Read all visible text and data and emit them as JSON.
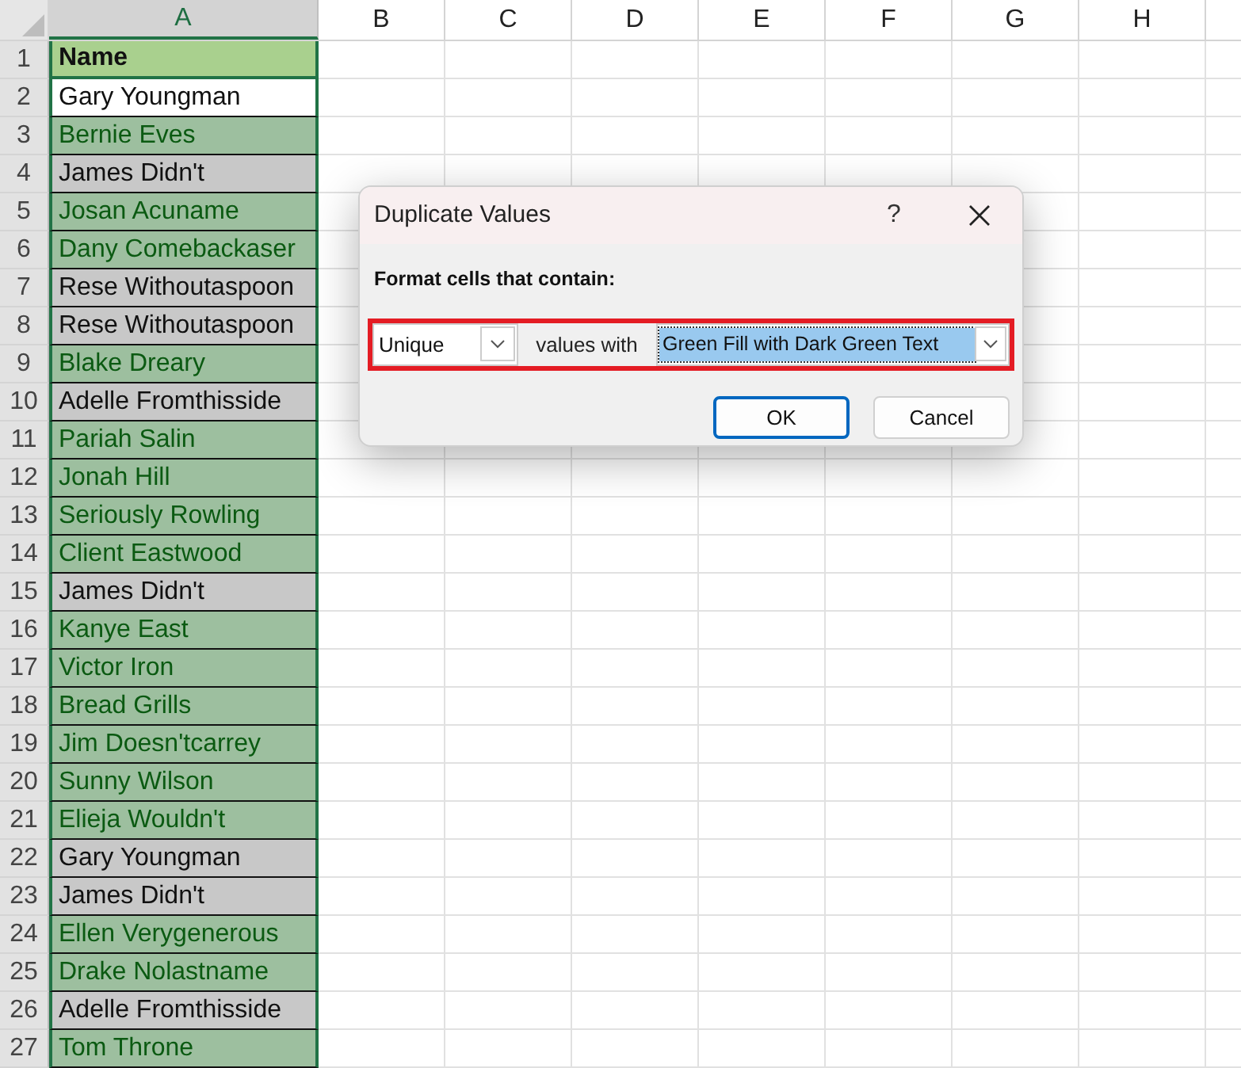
{
  "sheet": {
    "columns": [
      {
        "label": "A",
        "selected": true
      },
      {
        "label": "B",
        "selected": false
      },
      {
        "label": "C",
        "selected": false
      },
      {
        "label": "D",
        "selected": false
      },
      {
        "label": "E",
        "selected": false
      },
      {
        "label": "F",
        "selected": false
      },
      {
        "label": "G",
        "selected": false
      },
      {
        "label": "H",
        "selected": false
      }
    ],
    "rows": [
      {
        "number": "1",
        "value": "Name",
        "kind": "header"
      },
      {
        "number": "2",
        "value": "Gary Youngman",
        "kind": "active"
      },
      {
        "number": "3",
        "value": "Bernie Eves",
        "kind": "unique"
      },
      {
        "number": "4",
        "value": "James Didn't",
        "kind": "duplicate"
      },
      {
        "number": "5",
        "value": "Josan Acuname",
        "kind": "unique"
      },
      {
        "number": "6",
        "value": "Dany Comebackaser",
        "kind": "unique"
      },
      {
        "number": "7",
        "value": "Rese Withoutaspoon",
        "kind": "duplicate"
      },
      {
        "number": "8",
        "value": "Rese Withoutaspoon",
        "kind": "duplicate"
      },
      {
        "number": "9",
        "value": "Blake Dreary",
        "kind": "unique"
      },
      {
        "number": "10",
        "value": "Adelle Fromthisside",
        "kind": "duplicate"
      },
      {
        "number": "11",
        "value": "Pariah Salin",
        "kind": "unique"
      },
      {
        "number": "12",
        "value": "Jonah Hill",
        "kind": "unique"
      },
      {
        "number": "13",
        "value": "Seriously Rowling",
        "kind": "unique"
      },
      {
        "number": "14",
        "value": "Client Eastwood",
        "kind": "unique"
      },
      {
        "number": "15",
        "value": "James Didn't",
        "kind": "duplicate"
      },
      {
        "number": "16",
        "value": "Kanye East",
        "kind": "unique"
      },
      {
        "number": "17",
        "value": "Victor Iron",
        "kind": "unique"
      },
      {
        "number": "18",
        "value": "Bread Grills",
        "kind": "unique"
      },
      {
        "number": "19",
        "value": "Jim Doesn'tcarrey",
        "kind": "unique"
      },
      {
        "number": "20",
        "value": "Sunny Wilson",
        "kind": "unique"
      },
      {
        "number": "21",
        "value": "Elieja Wouldn't",
        "kind": "unique"
      },
      {
        "number": "22",
        "value": "Gary Youngman",
        "kind": "duplicate"
      },
      {
        "number": "23",
        "value": "James Didn't",
        "kind": "duplicate"
      },
      {
        "number": "24",
        "value": "Ellen Verygenerous",
        "kind": "unique"
      },
      {
        "number": "25",
        "value": "Drake Nolastname",
        "kind": "unique"
      },
      {
        "number": "26",
        "value": "Adelle Fromthisside",
        "kind": "duplicate"
      },
      {
        "number": "27",
        "value": "Tom Throne",
        "kind": "unique"
      }
    ]
  },
  "dialog": {
    "title": "Duplicate Values",
    "help": "?",
    "prompt": "Format cells that contain:",
    "rule_type": "Unique",
    "connector": "values with",
    "format": "Green Fill with Dark Green Text",
    "format_highlighted": true,
    "buttons": [
      {
        "label": "OK",
        "default": true
      },
      {
        "label": "Cancel",
        "default": false
      }
    ]
  }
}
